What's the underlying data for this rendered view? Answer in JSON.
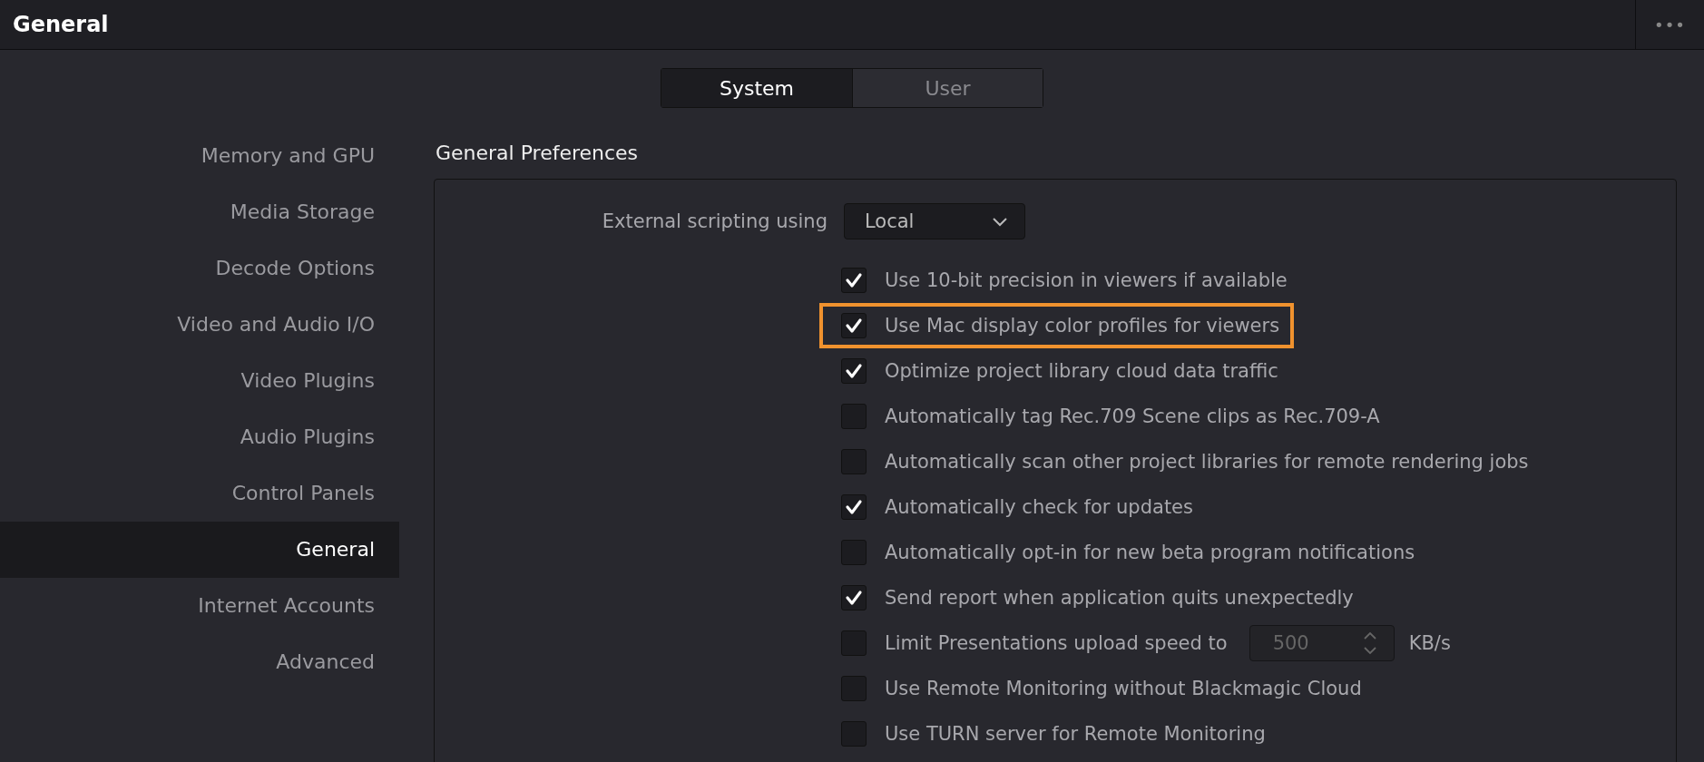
{
  "window": {
    "title": "General",
    "menu": "•••"
  },
  "tabs": [
    {
      "label": "System",
      "selected": true
    },
    {
      "label": "User",
      "selected": false
    }
  ],
  "sidebar": {
    "items": [
      {
        "label": "Memory and GPU",
        "selected": false
      },
      {
        "label": "Media Storage",
        "selected": false
      },
      {
        "label": "Decode Options",
        "selected": false
      },
      {
        "label": "Video and Audio I/O",
        "selected": false
      },
      {
        "label": "Video Plugins",
        "selected": false
      },
      {
        "label": "Audio Plugins",
        "selected": false
      },
      {
        "label": "Control Panels",
        "selected": false
      },
      {
        "label": "General",
        "selected": true
      },
      {
        "label": "Internet Accounts",
        "selected": false
      },
      {
        "label": "Advanced",
        "selected": false
      }
    ]
  },
  "section": {
    "title": "General Preferences",
    "scripting": {
      "label": "External scripting using",
      "value": "Local"
    },
    "options": [
      {
        "kind": "checkbox",
        "label": "Use 10-bit precision in viewers if available",
        "checked": true,
        "highlighted": false
      },
      {
        "kind": "checkbox",
        "label": "Use Mac display color profiles for viewers",
        "checked": true,
        "highlighted": true
      },
      {
        "kind": "checkbox",
        "label": "Optimize project library cloud data traffic",
        "checked": true,
        "highlighted": false
      },
      {
        "kind": "checkbox",
        "label": "Automatically tag Rec.709 Scene clips as Rec.709-A",
        "checked": false,
        "highlighted": false
      },
      {
        "kind": "checkbox",
        "label": "Automatically scan other project libraries for remote rendering jobs",
        "checked": false,
        "highlighted": false
      },
      {
        "kind": "checkbox",
        "label": "Automatically check for updates",
        "checked": true,
        "highlighted": false
      },
      {
        "kind": "checkbox",
        "label": "Automatically opt-in for new beta program notifications",
        "checked": false,
        "highlighted": false
      },
      {
        "kind": "checkbox",
        "label": "Send report when application quits unexpectedly",
        "checked": true,
        "highlighted": false
      },
      {
        "kind": "spin",
        "label": "Limit Presentations upload speed to",
        "checked": false,
        "highlighted": false,
        "value": "500",
        "unit": "KB/s"
      },
      {
        "kind": "checkbox",
        "label": "Use Remote Monitoring without Blackmagic Cloud",
        "checked": false,
        "highlighted": false
      },
      {
        "kind": "checkbox",
        "label": "Use TURN server for Remote Monitoring",
        "checked": false,
        "highlighted": false
      }
    ]
  }
}
